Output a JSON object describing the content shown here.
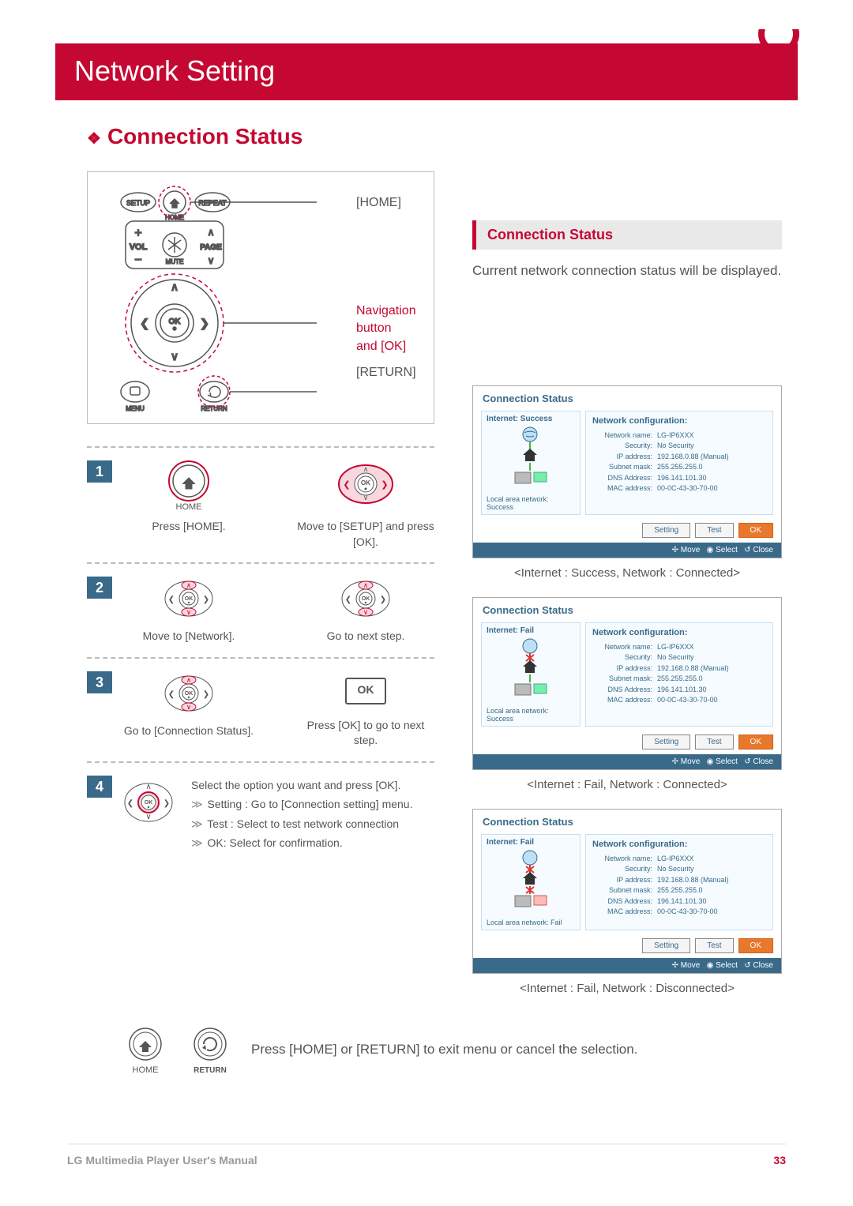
{
  "header": {
    "title": "Network Setting"
  },
  "section": {
    "title": "Connection Status"
  },
  "remote": {
    "home_label": "[HOME]",
    "nav_label": "Navigation button\nand [OK]",
    "return_label": "[RETURN]",
    "btns": {
      "setup": "SETUP",
      "repeat": "REPEAT",
      "home": "HOME",
      "vol": "VOL",
      "page": "PAGE",
      "mute": "MUTE",
      "ok": "OK",
      "menu": "MENU",
      "return": "RETURN"
    }
  },
  "steps": {
    "s1": {
      "n": "1",
      "left_label": "HOME",
      "left_cap": "Press [HOME].",
      "right_cap": "Move to [SETUP] and press [OK]."
    },
    "s2": {
      "n": "2",
      "left_cap": "Move to [Network].",
      "right_cap": "Go to next step."
    },
    "s3": {
      "n": "3",
      "left_cap": "Go to [Connection Status].",
      "right_cap": "Press [OK] to go  to next step.",
      "ok": "OK"
    },
    "s4": {
      "n": "4",
      "text": "Select the option you want and press [OK].",
      "b1": "Setting : Go to [Connection setting] menu.",
      "b2": "Test : Select to test network connection",
      "b3": "OK: Select for confirmation."
    }
  },
  "ok_small": "OK",
  "right": {
    "head": "Connection Status",
    "desc": "Current network connection status will be displayed."
  },
  "shots": {
    "title": "Connection Status",
    "nc": "Network configuration:",
    "btn_setting": "Setting",
    "btn_test": "Test",
    "btn_ok": "OK",
    "foot_move": "Move",
    "foot_select": "Select",
    "foot_close": "Close",
    "fields": {
      "network_name": {
        "k": "Network name:",
        "v": "LG-IP6XXX"
      },
      "security": {
        "k": "Security:",
        "v": "No Security"
      },
      "ip": {
        "k": "IP address:",
        "v": "192.168.0.88 (Manual)"
      },
      "subnet": {
        "k": "Subnet mask:",
        "v": "255.255.255.0"
      },
      "dns": {
        "k": "DNS Address:",
        "v": "196.141.101.30"
      },
      "mac": {
        "k": "MAC address:",
        "v": "00-0C-43-30-70-00"
      }
    },
    "s1": {
      "internet": "Internet: Success",
      "lan": "Local area network:   Success",
      "cap": "<Internet : Success, Network : Connected>"
    },
    "s2": {
      "internet": "Internet: Fail",
      "lan": "Local area network:   Success",
      "cap": "<Internet : Fail, Network : Connected>"
    },
    "s3": {
      "internet": "Internet: Fail",
      "lan": "Local area network:   Fail",
      "cap": "<Internet : Fail, Network : Disconnected>"
    }
  },
  "footer": {
    "txt": "Press [HOME] or [RETURN] to exit menu or cancel the selection.",
    "home": "HOME",
    "return": "RETURN"
  },
  "page_foot": {
    "left": "LG Multimedia Player User's Manual",
    "right": "33"
  }
}
